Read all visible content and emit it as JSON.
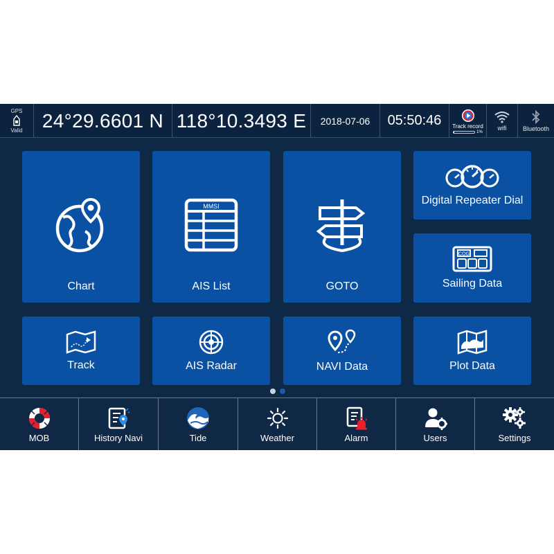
{
  "status_bar": {
    "gps": {
      "title": "GPS",
      "status": "Valid"
    },
    "latitude": "24°29.6601 N",
    "longitude": "118°10.3493 E",
    "date": "2018-07-06",
    "time": "05:50:46",
    "track_record": {
      "label": "Track record",
      "progress_percent": 1,
      "progress_text": "1%"
    },
    "wifi_label": "wifi",
    "bluetooth_label": "Bluetooth"
  },
  "tiles": {
    "chart": "Chart",
    "ais_list": "AIS List",
    "ais_list_icon_text": "MMSI",
    "goto": "GOTO",
    "digital_repeater_dial": "Digital Repeater Dial",
    "sailing_data": "Sailing Data",
    "sailing_data_icon_text": "COG",
    "track": "Track",
    "ais_radar": "AIS Radar",
    "navi_data": "NAVI Data",
    "plot_data": "Plot Data"
  },
  "pager": {
    "pages": 2,
    "current": 1
  },
  "bottom_bar": {
    "mob": "MOB",
    "history_navi": "History Navi",
    "tide": "Tide",
    "weather": "Weather",
    "alarm": "Alarm",
    "users": "Users",
    "settings": "Settings"
  },
  "colors": {
    "background": "#0e2946",
    "tile": "#0b51a3",
    "bar": "#0c2340",
    "accent_red": "#e8202a",
    "dot_active": "#c9d3df",
    "dot_inactive": "#1f5aa8"
  }
}
